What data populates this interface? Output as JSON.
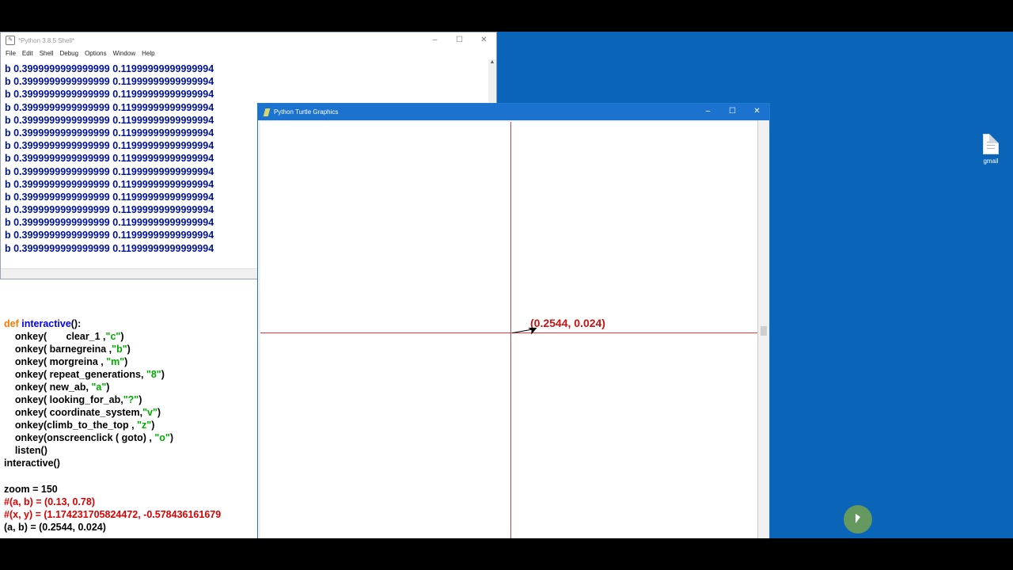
{
  "shell_window": {
    "title": "*Python 3.8.5 Shell*",
    "menu": [
      "File",
      "Edit",
      "Shell",
      "Debug",
      "Options",
      "Window",
      "Help"
    ],
    "output_lines": [
      "b 0.3999999999999999 0.11999999999999994",
      "b 0.3999999999999999 0.11999999999999994",
      "b 0.3999999999999999 0.11999999999999994",
      "b 0.3999999999999999 0.11999999999999994",
      "b 0.3999999999999999 0.11999999999999994",
      "b 0.3999999999999999 0.11999999999999994",
      "b 0.3999999999999999 0.11999999999999994",
      "b 0.3999999999999999 0.11999999999999994",
      "b 0.3999999999999999 0.11999999999999994",
      "b 0.3999999999999999 0.11999999999999994",
      "b 0.3999999999999999 0.11999999999999994",
      "b 0.3999999999999999 0.11999999999999994",
      "b 0.3999999999999999 0.11999999999999994",
      "b 0.3999999999999999 0.11999999999999994",
      "b 0.3999999999999999 0.11999999999999994"
    ],
    "controls": {
      "minimize": "–",
      "maximize": "☐",
      "close": "✕"
    }
  },
  "editor": {
    "def_kw": "def",
    "def_name": "interactive",
    "def_tail": "():",
    "onkey_calls": [
      {
        "head": "    onkey(       clear_1 ,",
        "arg": "\"c\"",
        "tail": ")"
      },
      {
        "head": "    onkey( barnegreina ,",
        "arg": "\"b\"",
        "tail": ")"
      },
      {
        "head": "    onkey( morgreina , ",
        "arg": "\"m\"",
        "tail": ")"
      },
      {
        "head": "    onkey( repeat_generations, ",
        "arg": "\"8\"",
        "tail": ")"
      },
      {
        "head": "    onkey( new_ab, ",
        "arg": "\"a\"",
        "tail": ")"
      },
      {
        "head": "    onkey( looking_for_ab,",
        "arg": "\"?\"",
        "tail": ")"
      },
      {
        "head": "    onkey( coordinate_system,",
        "arg": "\"v\"",
        "tail": ")"
      },
      {
        "head": "    onkey(climb_to_the_top , ",
        "arg": "\"z\"",
        "tail": ")"
      },
      {
        "head": "    onkey(onscreenclick ( goto) , ",
        "arg": "\"o\"",
        "tail": ")"
      }
    ],
    "listen_line": "    listen()",
    "call_line": "interactive()",
    "zoom_line": "zoom = 150",
    "comment1": "#(a, b) = (0.13, 0.78)",
    "comment2": "#(x, y) = (1.174231705824472, -0.578436161679",
    "ab_line": "(a, b) = (0.2544, 0.024)"
  },
  "turtle_window": {
    "title": "Python Turtle Graphics",
    "point_label": "(0.2544, 0.024)",
    "controls": {
      "minimize": "–",
      "maximize": "☐",
      "close": "✕"
    },
    "axis_color": "#e63a3a"
  },
  "desktop": {
    "icon_label": "gmail",
    "background_color": "#0a64b8"
  }
}
